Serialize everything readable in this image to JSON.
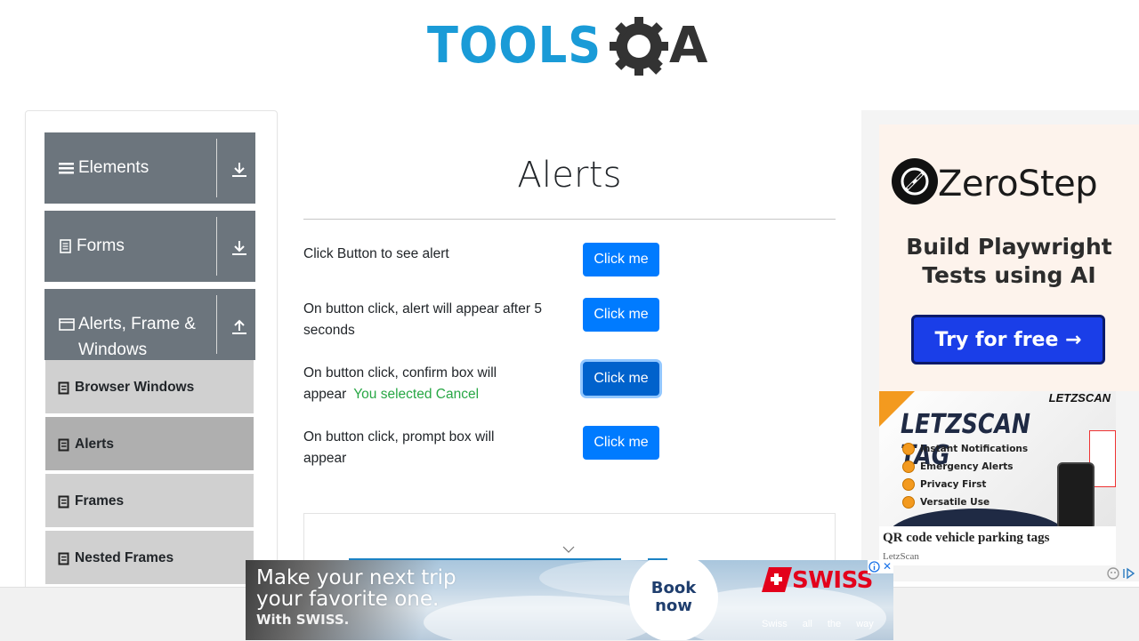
{
  "header": {
    "logo_text_left": "TOOLS",
    "logo_text_right": "A"
  },
  "sidebar": {
    "groups": [
      {
        "label": "Elements",
        "icon": "hamburger-icon",
        "arrow": "download-arrow-icon"
      },
      {
        "label": "Forms",
        "icon": "document-icon",
        "arrow": "download-arrow-icon"
      },
      {
        "label": "Alerts, Frame & Windows",
        "label_line1": "Alerts, Frame &",
        "label_line2": "Windows",
        "icon": "window-icon",
        "arrow": "upload-arrow-icon",
        "expanded": true
      }
    ],
    "items": [
      {
        "label": "Browser Windows",
        "active": false
      },
      {
        "label": "Alerts",
        "active": true
      },
      {
        "label": "Frames",
        "active": false
      },
      {
        "label": "Nested Frames",
        "active": false
      }
    ]
  },
  "main": {
    "title": "Alerts",
    "rows": [
      {
        "label": "Click Button to see alert",
        "button": "Click me"
      },
      {
        "label": "On button click, alert will appear after 5 seconds",
        "label_line1": "On button click, alert will appear after 5",
        "label_line2": "seconds",
        "button": "Click me"
      },
      {
        "label_line1": "On button click, confirm box will",
        "label_line2": "appear",
        "result": "You selected Cancel",
        "button": "Click me"
      },
      {
        "label_line1": "On button click, prompt box will",
        "label_line2": "appear",
        "button": "Click me"
      }
    ]
  },
  "ads": {
    "zerostep": {
      "brand": "ZeroStep",
      "tagline_line1": "Build Playwright",
      "tagline_line2": "Tests using AI",
      "cta": "Try for free →"
    },
    "letzscan": {
      "logo": "LETZSCAN",
      "title": "LETZSCAN TAG",
      "features": [
        "Instant Notifications",
        "Emergency Alerts",
        "Privacy First",
        "Versatile Use"
      ],
      "headline": "QR code vehicle parking tags",
      "source": "LetzScan"
    },
    "swiss": {
      "headline_line1": "Make your next trip",
      "headline_line2": "your favorite one.",
      "sub": "With SWISS.",
      "book_line1": "Book",
      "book_line2": "now",
      "brand": "SWISS",
      "slogan": "Swiss all the way",
      "close": "✕"
    }
  },
  "colors": {
    "primary_button": "#007bff",
    "sidebar_group": "#6c757d",
    "sidebar_item": "#d0d0d0",
    "sidebar_item_active": "#afafaf",
    "success_text": "#28a745",
    "logo_blue": "#1a9bd7",
    "logo_dark": "#333333"
  }
}
